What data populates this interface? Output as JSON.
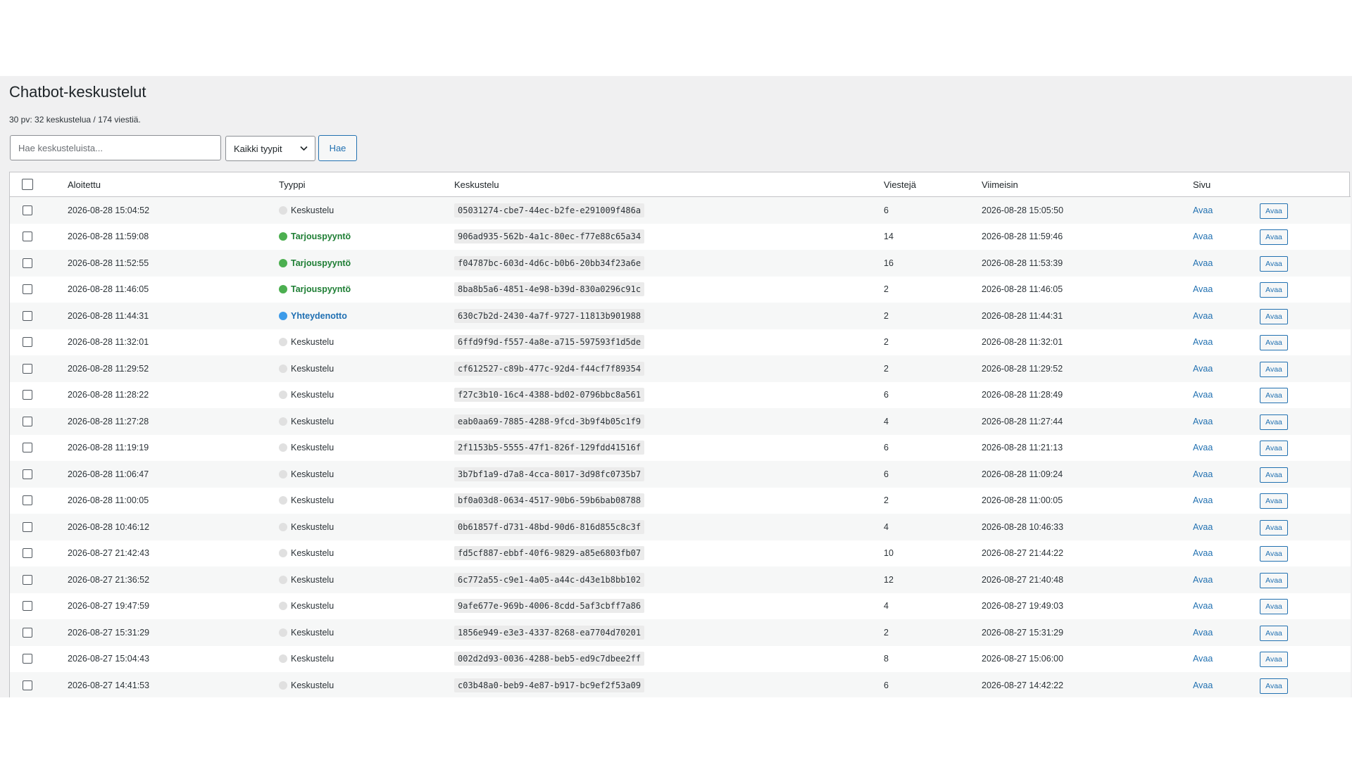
{
  "page": {
    "title": "Chatbot-keskustelut",
    "summary": "30 pv: 32 keskustelua / 174 viestiä."
  },
  "filters": {
    "search_placeholder": "Hae keskusteluista...",
    "type_select_value": "Kaikki tyypit",
    "search_button": "Hae"
  },
  "table": {
    "headers": [
      "Aloitettu",
      "Tyyppi",
      "Keskustelu",
      "Viestejä",
      "Viimeisin",
      "Sivu"
    ],
    "rows": [
      {
        "started": "2026-08-28 15:04:52",
        "type": "Keskustelu",
        "type_color": "#e0e0e0",
        "type_text_color": "#2c3338",
        "id": "05031274-cbe7-44ec-b2fe-e291009f486a",
        "messages": "6",
        "latest": "2026-08-28 15:05:50",
        "page_link": "Avaa",
        "action": "Avaa"
      },
      {
        "started": "2026-08-28 11:59:08",
        "type": "Tarjouspyyntö",
        "type_color": "#4caf50",
        "type_text_color": "#1e7e34",
        "id": "906ad935-562b-4a1c-80ec-f77e88c65a34",
        "messages": "14",
        "latest": "2026-08-28 11:59:46",
        "page_link": "Avaa",
        "action": "Avaa"
      },
      {
        "started": "2026-08-28 11:52:55",
        "type": "Tarjouspyyntö",
        "type_color": "#4caf50",
        "type_text_color": "#1e7e34",
        "id": "f04787bc-603d-4d6c-b0b6-20bb34f23a6e",
        "messages": "16",
        "latest": "2026-08-28 11:53:39",
        "page_link": "Avaa",
        "action": "Avaa"
      },
      {
        "started": "2026-08-28 11:46:05",
        "type": "Tarjouspyyntö",
        "type_color": "#4caf50",
        "type_text_color": "#1e7e34",
        "id": "8ba8b5a6-4851-4e98-b39d-830a0296c91c",
        "messages": "2",
        "latest": "2026-08-28 11:46:05",
        "page_link": "Avaa",
        "action": "Avaa"
      },
      {
        "started": "2026-08-28 11:44:31",
        "type": "Yhteydenotto",
        "type_color": "#3d9be9",
        "type_text_color": "#1f6fb2",
        "id": "630c7b2d-2430-4a7f-9727-11813b901988",
        "messages": "2",
        "latest": "2026-08-28 11:44:31",
        "page_link": "Avaa",
        "action": "Avaa"
      },
      {
        "started": "2026-08-28 11:32:01",
        "type": "Keskustelu",
        "type_color": "#e0e0e0",
        "type_text_color": "#2c3338",
        "id": "6ffd9f9d-f557-4a8e-a715-597593f1d5de",
        "messages": "2",
        "latest": "2026-08-28 11:32:01",
        "page_link": "Avaa",
        "action": "Avaa"
      },
      {
        "started": "2026-08-28 11:29:52",
        "type": "Keskustelu",
        "type_color": "#e0e0e0",
        "type_text_color": "#2c3338",
        "id": "cf612527-c89b-477c-92d4-f44cf7f89354",
        "messages": "2",
        "latest": "2026-08-28 11:29:52",
        "page_link": "Avaa",
        "action": "Avaa"
      },
      {
        "started": "2026-08-28 11:28:22",
        "type": "Keskustelu",
        "type_color": "#e0e0e0",
        "type_text_color": "#2c3338",
        "id": "f27c3b10-16c4-4388-bd02-0796bbc8a561",
        "messages": "6",
        "latest": "2026-08-28 11:28:49",
        "page_link": "Avaa",
        "action": "Avaa"
      },
      {
        "started": "2026-08-28 11:27:28",
        "type": "Keskustelu",
        "type_color": "#e0e0e0",
        "type_text_color": "#2c3338",
        "id": "eab0aa69-7885-4288-9fcd-3b9f4b05c1f9",
        "messages": "4",
        "latest": "2026-08-28 11:27:44",
        "page_link": "Avaa",
        "action": "Avaa"
      },
      {
        "started": "2026-08-28 11:19:19",
        "type": "Keskustelu",
        "type_color": "#e0e0e0",
        "type_text_color": "#2c3338",
        "id": "2f1153b5-5555-47f1-826f-129fdd41516f",
        "messages": "6",
        "latest": "2026-08-28 11:21:13",
        "page_link": "Avaa",
        "action": "Avaa"
      },
      {
        "started": "2026-08-28 11:06:47",
        "type": "Keskustelu",
        "type_color": "#e0e0e0",
        "type_text_color": "#2c3338",
        "id": "3b7bf1a9-d7a8-4cca-8017-3d98fc0735b7",
        "messages": "6",
        "latest": "2026-08-28 11:09:24",
        "page_link": "Avaa",
        "action": "Avaa"
      },
      {
        "started": "2026-08-28 11:00:05",
        "type": "Keskustelu",
        "type_color": "#e0e0e0",
        "type_text_color": "#2c3338",
        "id": "bf0a03d8-0634-4517-90b6-59b6bab08788",
        "messages": "2",
        "latest": "2026-08-28 11:00:05",
        "page_link": "Avaa",
        "action": "Avaa"
      },
      {
        "started": "2026-08-28 10:46:12",
        "type": "Keskustelu",
        "type_color": "#e0e0e0",
        "type_text_color": "#2c3338",
        "id": "0b61857f-d731-48bd-90d6-816d855c8c3f",
        "messages": "4",
        "latest": "2026-08-28 10:46:33",
        "page_link": "Avaa",
        "action": "Avaa"
      },
      {
        "started": "2026-08-27 21:42:43",
        "type": "Keskustelu",
        "type_color": "#e0e0e0",
        "type_text_color": "#2c3338",
        "id": "fd5cf887-ebbf-40f6-9829-a85e6803fb07",
        "messages": "10",
        "latest": "2026-08-27 21:44:22",
        "page_link": "Avaa",
        "action": "Avaa"
      },
      {
        "started": "2026-08-27 21:36:52",
        "type": "Keskustelu",
        "type_color": "#e0e0e0",
        "type_text_color": "#2c3338",
        "id": "6c772a55-c9e1-4a05-a44c-d43e1b8bb102",
        "messages": "12",
        "latest": "2026-08-27 21:40:48",
        "page_link": "Avaa",
        "action": "Avaa"
      },
      {
        "started": "2026-08-27 19:47:59",
        "type": "Keskustelu",
        "type_color": "#e0e0e0",
        "type_text_color": "#2c3338",
        "id": "9afe677e-969b-4006-8cdd-5af3cbff7a86",
        "messages": "4",
        "latest": "2026-08-27 19:49:03",
        "page_link": "Avaa",
        "action": "Avaa"
      },
      {
        "started": "2026-08-27 15:31:29",
        "type": "Keskustelu",
        "type_color": "#e0e0e0",
        "type_text_color": "#2c3338",
        "id": "1856e949-e3e3-4337-8268-ea7704d70201",
        "messages": "2",
        "latest": "2026-08-27 15:31:29",
        "page_link": "Avaa",
        "action": "Avaa"
      },
      {
        "started": "2026-08-27 15:04:43",
        "type": "Keskustelu",
        "type_color": "#e0e0e0",
        "type_text_color": "#2c3338",
        "id": "002d2d93-0036-4288-beb5-ed9c7dbee2ff",
        "messages": "8",
        "latest": "2026-08-27 15:06:00",
        "page_link": "Avaa",
        "action": "Avaa"
      },
      {
        "started": "2026-08-27 14:41:53",
        "type": "Keskustelu",
        "type_color": "#e0e0e0",
        "type_text_color": "#2c3338",
        "id": "c03b48a0-beb9-4e87-b917-bc9ef2f53a09",
        "messages": "6",
        "latest": "2026-08-27 14:42:22",
        "page_link": "Avaa",
        "action": "Avaa"
      }
    ]
  },
  "colors": {
    "accent": "#2271b1",
    "admin_background": "#f0f0f1"
  }
}
